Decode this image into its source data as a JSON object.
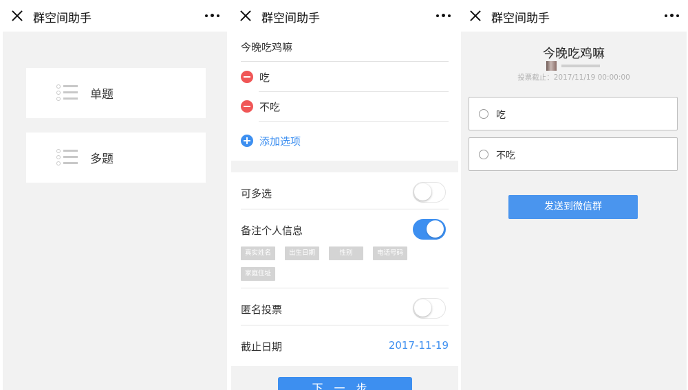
{
  "app": {
    "title": "群空间助手",
    "close_icon": "close-icon",
    "more_icon": "more-icon"
  },
  "type_select": {
    "options": [
      {
        "label": "单题",
        "icon": "list-icon"
      },
      {
        "label": "多题",
        "icon": "list-icon"
      }
    ]
  },
  "create_form": {
    "question": "今晚吃鸡嘛",
    "options": [
      "吃",
      "不吃"
    ],
    "add_option_label": "添加选项",
    "multi_select": {
      "label": "可多选",
      "on": false
    },
    "personal_info": {
      "label": "备注个人信息",
      "on": true,
      "fields": [
        "真实姓名",
        "出生日期",
        "性别",
        "电话号码",
        "家庭住址"
      ]
    },
    "anonymous": {
      "label": "匿名投票",
      "on": false
    },
    "deadline": {
      "label": "截止日期",
      "value": "2017-11-19"
    },
    "next_button": "下一步"
  },
  "preview": {
    "title": "今晚吃鸡嘛",
    "deadline_text": "投票截止：2017/11/19 00:00:00",
    "options": [
      "吃",
      "不吃"
    ],
    "send_button": "发送到微信群"
  },
  "colors": {
    "accent": "#3d8ff0",
    "danger": "#f05656",
    "background": "#f2f2f2"
  }
}
